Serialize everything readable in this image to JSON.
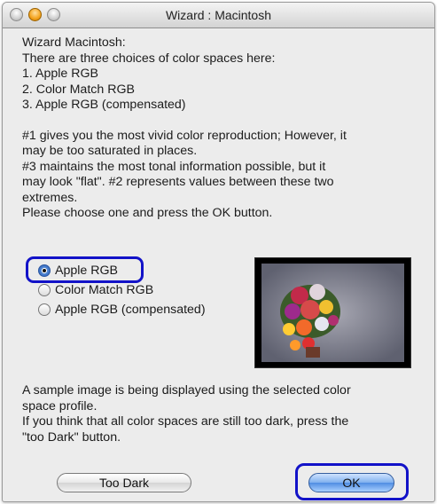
{
  "window": {
    "title": "Wizard : Macintosh"
  },
  "intro": {
    "lines": [
      "Wizard Macintosh:",
      "There are three choices of color spaces here:",
      "1. Apple RGB",
      "2. Color Match RGB",
      "3. Apple RGB (compensated)"
    ]
  },
  "description": {
    "lines": [
      "#1 gives you the most vivid color reproduction; However, it",
      "may be too saturated in places.",
      "#3 maintains the most tonal information possible, but it",
      "may look \"flat\". #2 represents values between these two",
      "extremes.",
      "Please choose one and press the OK button."
    ]
  },
  "options": [
    {
      "label": "Apple RGB",
      "selected": true
    },
    {
      "label": "Color Match RGB",
      "selected": false
    },
    {
      "label": "Apple RGB (compensated)",
      "selected": false
    }
  ],
  "note": {
    "lines": [
      "A sample image is being displayed using the selected color",
      "space profile.",
      "If you think that all color spaces are still too dark, press the",
      "\"too Dark\" button."
    ]
  },
  "buttons": {
    "too_dark": "Too Dark",
    "ok": "OK"
  },
  "colors": {
    "highlight": "#1212c8",
    "window_bg": "#ececec",
    "ok_blue": "#4f8de2"
  }
}
